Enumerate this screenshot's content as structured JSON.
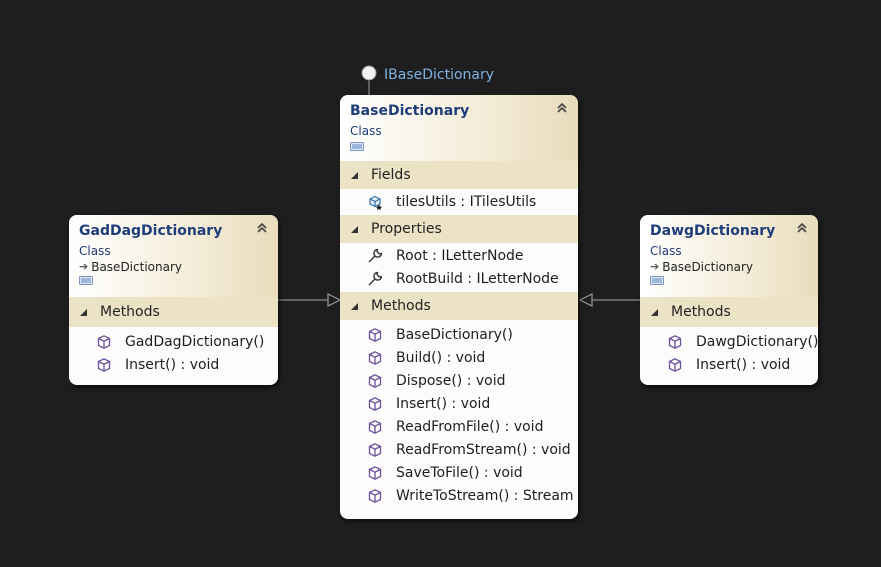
{
  "interface": {
    "name": "IBaseDictionary"
  },
  "classes": {
    "base": {
      "name": "BaseDictionary",
      "stereotype": "Class",
      "sections": {
        "fields": {
          "label": "Fields",
          "items": [
            "tilesUtils : ITilesUtils"
          ]
        },
        "properties": {
          "label": "Properties",
          "items": [
            "Root : ILetterNode",
            "RootBuild : ILetterNode"
          ]
        },
        "methods": {
          "label": "Methods",
          "items": [
            "BaseDictionary()",
            "Build() : void",
            "Dispose() : void",
            "Insert() : void",
            "ReadFromFile() : void",
            "ReadFromStream() : void",
            "SaveToFile() : void",
            "WriteToStream() : Stream"
          ]
        }
      }
    },
    "gaddag": {
      "name": "GadDagDictionary",
      "stereotype": "Class",
      "base_class": "BaseDictionary",
      "sections": {
        "methods": {
          "label": "Methods",
          "items": [
            "GadDagDictionary()",
            "Insert() : void"
          ]
        }
      }
    },
    "dawg": {
      "name": "DawgDictionary",
      "stereotype": "Class",
      "base_class": "BaseDictionary",
      "sections": {
        "methods": {
          "label": "Methods",
          "items": [
            "DawgDictionary()",
            "Insert() : void"
          ]
        }
      }
    }
  },
  "colors": {
    "background": "#1e1e1e",
    "class_name": "#1f3d7a",
    "interface_label": "#7fb0e0",
    "section_header": "#ece2c6",
    "method_icon": "#6b4f9a",
    "connector": "#8a8a8a"
  },
  "icons": {
    "collapse": "double-chevron-up-icon",
    "section_toggle": "triangle-expanded-icon",
    "field": "field-icon",
    "property": "wrench-icon",
    "method": "cube-method-icon",
    "inheritance": "inheritance-arrow-icon",
    "class_badge": "class-badge-icon",
    "lollipop": "interface-lollipop-icon"
  }
}
